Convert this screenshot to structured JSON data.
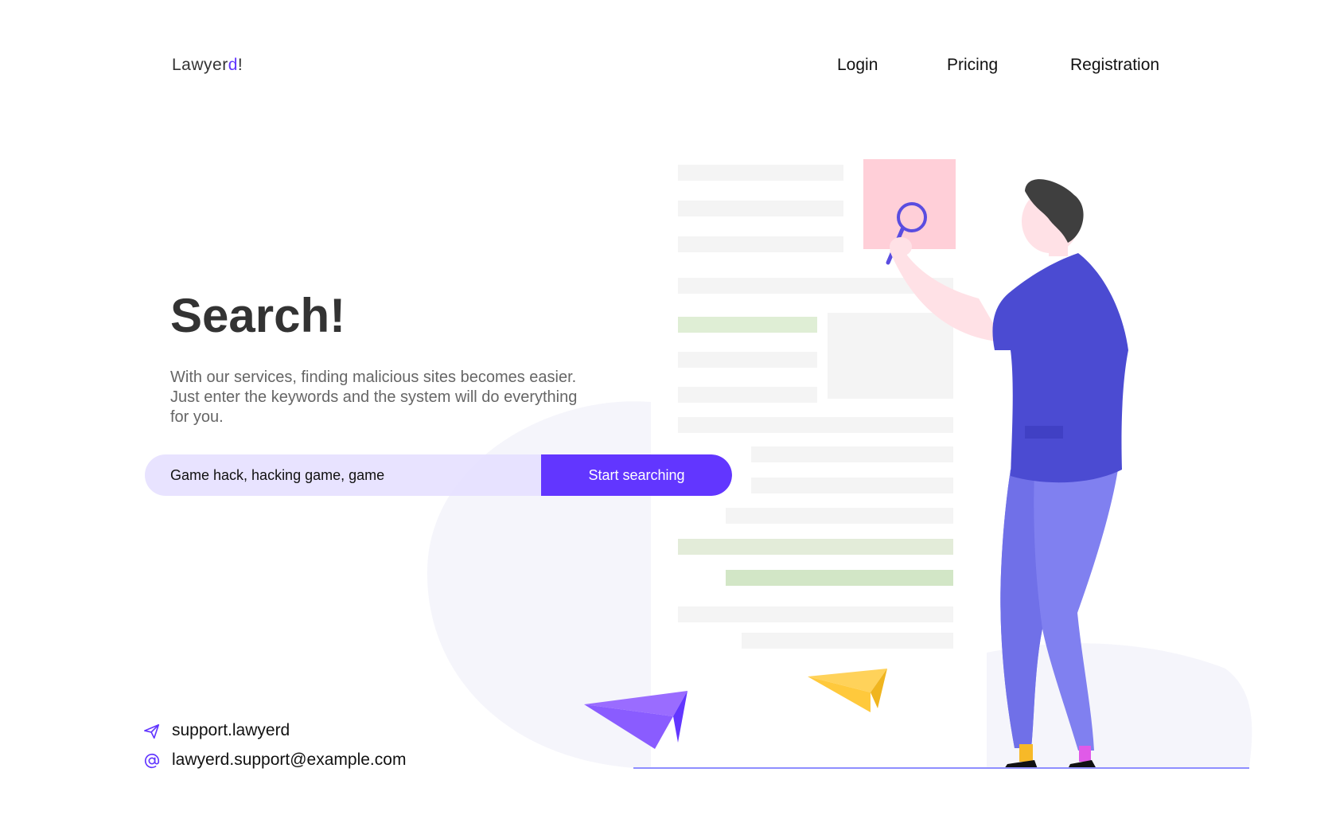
{
  "brand": {
    "name_prefix": "Lawyer",
    "name_accent": "d",
    "name_suffix": "!"
  },
  "nav": {
    "items": [
      {
        "label": "Login"
      },
      {
        "label": "Pricing"
      },
      {
        "label": "Registration"
      }
    ]
  },
  "hero": {
    "title": "Search!",
    "description": "With our services, finding malicious sites becomes easier. Just enter the keywords and the system will do everything for you."
  },
  "search": {
    "value": "Game hack, hacking game, game",
    "button_label": "Start searching"
  },
  "contacts": {
    "support": {
      "icon": "paper-plane-icon",
      "text": "support.lawyerd"
    },
    "email": {
      "icon": "at-sign-icon",
      "text": "lawyerd.support@example.com"
    }
  },
  "colors": {
    "accent": "#6236ff",
    "input_bg": "#e6e0ff",
    "heading": "#333333",
    "body_text": "#666666",
    "illustration_shirt": "#4b4bd2",
    "illustration_pants": "#8080f0",
    "illustration_note": "#ffcfd8",
    "illustration_plane_yellow": "#ffd25a",
    "illustration_plane_purple": "#9a6cff"
  }
}
